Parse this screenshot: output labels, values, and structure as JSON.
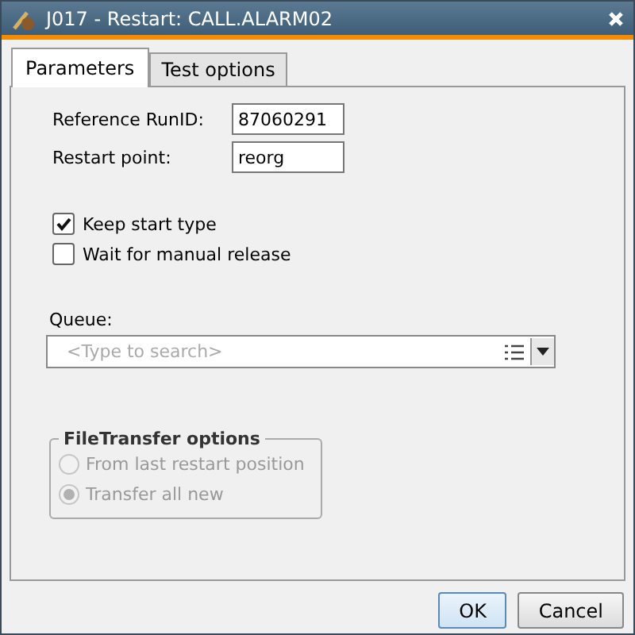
{
  "window": {
    "title": "J017 - Restart: CALL.ALARM02"
  },
  "tabs": [
    {
      "label": "Parameters",
      "selected": true
    },
    {
      "label": "Test options",
      "selected": false
    }
  ],
  "fields": [
    {
      "label": "Reference RunID:",
      "value": "87060291"
    },
    {
      "label": "Restart point:",
      "value": "reorg"
    }
  ],
  "checkboxes": [
    {
      "label": "Keep start type",
      "checked": true
    },
    {
      "label": "Wait for manual release",
      "checked": false
    }
  ],
  "queue": {
    "label": "Queue:",
    "placeholder": "<Type to search>"
  },
  "file_transfer": {
    "title": "FileTransfer options",
    "disabled": true,
    "options": [
      {
        "label": "From last restart position",
        "selected": false
      },
      {
        "label": "Transfer all new",
        "selected": true
      }
    ]
  },
  "buttons": [
    "OK",
    "Cancel"
  ]
}
